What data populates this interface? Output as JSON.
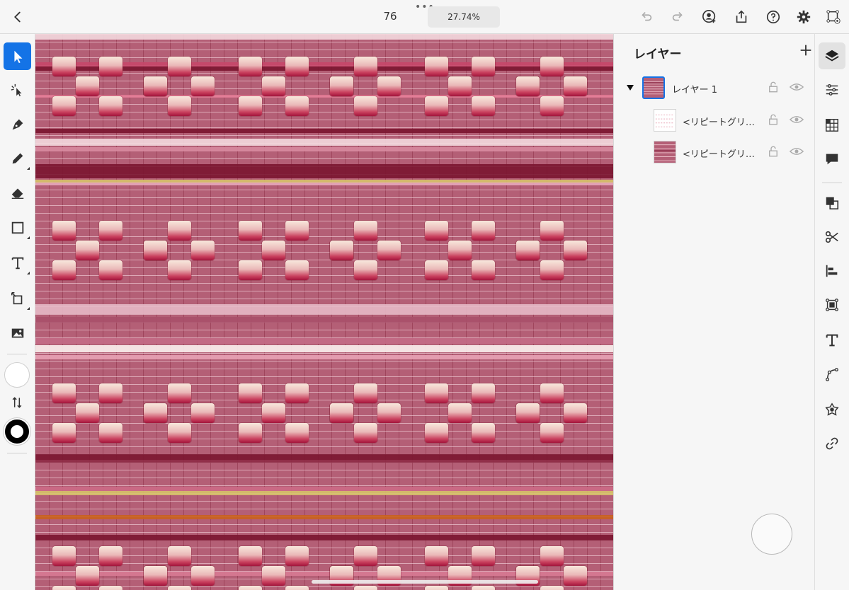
{
  "topbar": {
    "doc_number": "76",
    "more_dots": "•••",
    "zoom": "27.74%"
  },
  "left_toolbar": {
    "tools": [
      "selection-tool",
      "direct-selection-tool",
      "pen-tool",
      "pencil-tool",
      "eraser-tool",
      "rectangle-tool",
      "type-tool",
      "transform-tool",
      "image-tool"
    ],
    "active_tool": "selection-tool",
    "fill_color": "#ffffff",
    "stroke_color": "#000000"
  },
  "canvas": {
    "pattern_colors": {
      "base": "#b45f76",
      "dark_band": "#7a1530",
      "light_band": "#f3d9df",
      "gold_band": "#d6c36a",
      "orange_band": "#c9621f",
      "tile_top": "#f8e8dc",
      "tile_bottom": "#a3153c"
    }
  },
  "layers_panel": {
    "title": "レイヤー",
    "layers": [
      {
        "name": "レイヤー 1",
        "expanded": true,
        "selected": true
      },
      {
        "name": "<リピートグリ…"
      },
      {
        "name": "<リピートグリ…"
      }
    ]
  },
  "right_rail": {
    "icons": [
      "layers-icon",
      "properties-icon",
      "repeat-grid-icon",
      "comments-icon",
      "combine-icon",
      "scissors-icon",
      "align-icon",
      "transform-bounds-icon",
      "text-icon",
      "path-icon",
      "effects-icon",
      "link-icon"
    ],
    "active": "layers-icon"
  },
  "accent": "#1473e6"
}
